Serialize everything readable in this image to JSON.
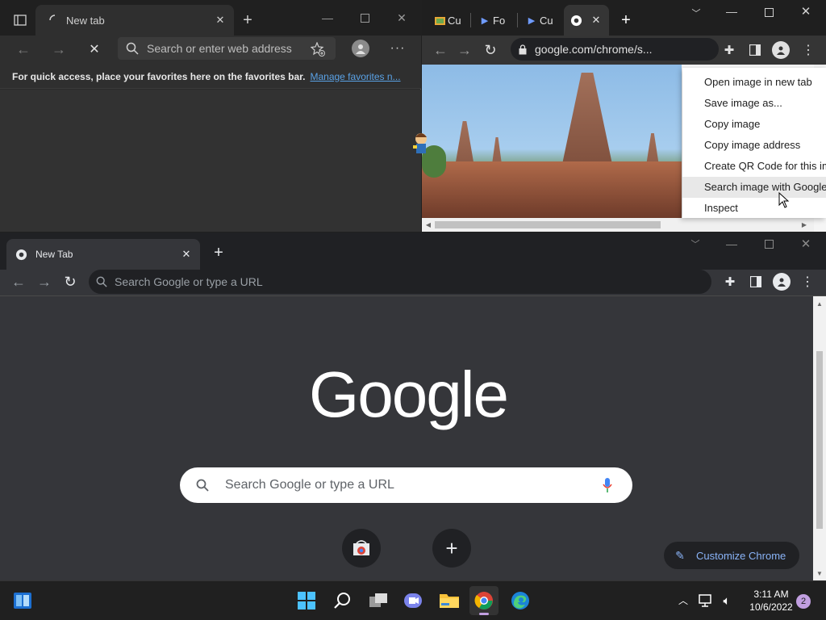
{
  "edge": {
    "tab_title": "New tab",
    "address_placeholder": "Search or enter web address",
    "favorites_text": "For quick access, place your favorites here on the favorites bar.",
    "favorites_link": "Manage favorites n..."
  },
  "chrome_top": {
    "tabs": [
      "Cu",
      "Fo",
      "Cu"
    ],
    "url": "google.com/chrome/s...",
    "context_menu": [
      "Open image in new tab",
      "Save image as...",
      "Copy image",
      "Copy image address",
      "Create QR Code for this image",
      "Search image with Google",
      "Inspect"
    ]
  },
  "chrome_bottom": {
    "tab_title": "New Tab",
    "omnibox_placeholder": "Search Google or type a URL",
    "logo": "Google",
    "search_placeholder": "Search Google or type a URL",
    "customize": "Customize Chrome"
  },
  "taskbar": {
    "time": "3:11 AM",
    "date": "10/6/2022",
    "notifications": "2"
  },
  "colors": {
    "accent_blue": "#5aa2e6",
    "chrome_blue": "#8ab4f8"
  }
}
